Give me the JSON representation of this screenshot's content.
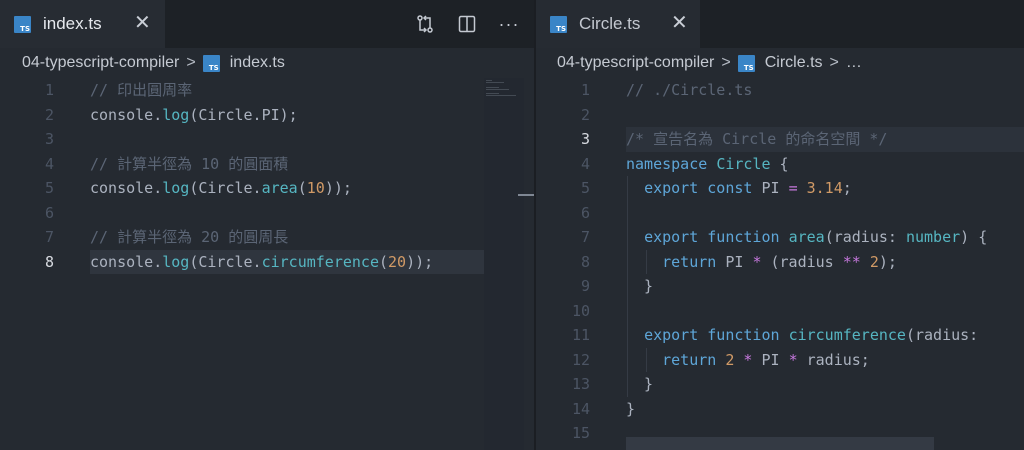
{
  "left": {
    "tab": {
      "icon_text": "TS",
      "name": "index.ts",
      "close": "✕"
    },
    "actions": {
      "compare_icon": "git-compare-icon",
      "split_icon": "split-editor-icon",
      "more": "···"
    },
    "breadcrumb": {
      "folder": "04-typescript-compiler",
      "sep": ">",
      "file": "index.ts"
    },
    "active_line": 8,
    "lines": [
      {
        "n": "1",
        "tokens": [
          {
            "t": "// 印出圓周率",
            "c": "comment"
          }
        ]
      },
      {
        "n": "2",
        "tokens": [
          {
            "t": "console",
            "c": "ident"
          },
          {
            "t": ".",
            "c": "punc"
          },
          {
            "t": "log",
            "c": "fn"
          },
          {
            "t": "(Circle.PI);",
            "c": "punc"
          }
        ]
      },
      {
        "n": "3",
        "tokens": []
      },
      {
        "n": "4",
        "tokens": [
          {
            "t": "// 計算半徑為 10 的圓面積",
            "c": "comment"
          }
        ]
      },
      {
        "n": "5",
        "tokens": [
          {
            "t": "console",
            "c": "ident"
          },
          {
            "t": ".",
            "c": "punc"
          },
          {
            "t": "log",
            "c": "fn"
          },
          {
            "t": "(Circle.",
            "c": "punc"
          },
          {
            "t": "area",
            "c": "fn"
          },
          {
            "t": "(",
            "c": "punc"
          },
          {
            "t": "10",
            "c": "num"
          },
          {
            "t": "));",
            "c": "punc"
          }
        ]
      },
      {
        "n": "6",
        "tokens": []
      },
      {
        "n": "7",
        "tokens": [
          {
            "t": "// 計算半徑為 20 的圓周長",
            "c": "comment"
          }
        ]
      },
      {
        "n": "8",
        "tokens": [
          {
            "t": "console",
            "c": "ident"
          },
          {
            "t": ".",
            "c": "punc"
          },
          {
            "t": "log",
            "c": "fn"
          },
          {
            "t": "(Circle.",
            "c": "punc"
          },
          {
            "t": "circumference",
            "c": "fn"
          },
          {
            "t": "(",
            "c": "punc"
          },
          {
            "t": "20",
            "c": "num"
          },
          {
            "t": "));",
            "c": "punc"
          }
        ]
      }
    ]
  },
  "right": {
    "tab": {
      "icon_text": "TS",
      "name": "Circle.ts",
      "close": "✕"
    },
    "breadcrumb": {
      "folder": "04-typescript-compiler",
      "sep": ">",
      "file": "Circle.ts",
      "sep2": ">",
      "more": "…"
    },
    "active_line": 3,
    "lines": [
      {
        "n": "1",
        "tokens": [
          {
            "t": "// ./Circle.ts",
            "c": "comment"
          }
        ]
      },
      {
        "n": "2",
        "tokens": []
      },
      {
        "n": "3",
        "tokens": [
          {
            "t": "/* 宣告名為 Circle 的命名空間 */",
            "c": "comment"
          }
        ]
      },
      {
        "n": "4",
        "tokens": [
          {
            "t": "namespace ",
            "c": "kw"
          },
          {
            "t": "Circle",
            "c": "type"
          },
          {
            "t": " {",
            "c": "punc"
          }
        ]
      },
      {
        "n": "5",
        "tokens": [
          {
            "t": "  ",
            "c": "punc"
          },
          {
            "t": "export ",
            "c": "kw"
          },
          {
            "t": "const ",
            "c": "kw"
          },
          {
            "t": "PI ",
            "c": "ident"
          },
          {
            "t": "= ",
            "c": "op"
          },
          {
            "t": "3.14",
            "c": "num"
          },
          {
            "t": ";",
            "c": "punc"
          }
        ]
      },
      {
        "n": "6",
        "tokens": []
      },
      {
        "n": "7",
        "tokens": [
          {
            "t": "  ",
            "c": "punc"
          },
          {
            "t": "export ",
            "c": "kw"
          },
          {
            "t": "function ",
            "c": "kw"
          },
          {
            "t": "area",
            "c": "fn"
          },
          {
            "t": "(radius: ",
            "c": "punc"
          },
          {
            "t": "number",
            "c": "type"
          },
          {
            "t": ") {",
            "c": "punc"
          }
        ]
      },
      {
        "n": "8",
        "tokens": [
          {
            "t": "    ",
            "c": "punc"
          },
          {
            "t": "return ",
            "c": "kw"
          },
          {
            "t": "PI ",
            "c": "ident"
          },
          {
            "t": "* ",
            "c": "op"
          },
          {
            "t": "(radius ",
            "c": "punc"
          },
          {
            "t": "** ",
            "c": "op"
          },
          {
            "t": "2",
            "c": "num"
          },
          {
            "t": ");",
            "c": "punc"
          }
        ]
      },
      {
        "n": "9",
        "tokens": [
          {
            "t": "  }",
            "c": "punc"
          }
        ]
      },
      {
        "n": "10",
        "tokens": []
      },
      {
        "n": "11",
        "tokens": [
          {
            "t": "  ",
            "c": "punc"
          },
          {
            "t": "export ",
            "c": "kw"
          },
          {
            "t": "function ",
            "c": "kw"
          },
          {
            "t": "circumference",
            "c": "fn"
          },
          {
            "t": "(radius:",
            "c": "punc"
          }
        ]
      },
      {
        "n": "12",
        "tokens": [
          {
            "t": "    ",
            "c": "punc"
          },
          {
            "t": "return ",
            "c": "kw"
          },
          {
            "t": "2 ",
            "c": "num"
          },
          {
            "t": "* ",
            "c": "op"
          },
          {
            "t": "PI ",
            "c": "ident"
          },
          {
            "t": "* ",
            "c": "op"
          },
          {
            "t": "radius;",
            "c": "punc"
          }
        ]
      },
      {
        "n": "13",
        "tokens": [
          {
            "t": "  }",
            "c": "punc"
          }
        ]
      },
      {
        "n": "14",
        "tokens": [
          {
            "t": "}",
            "c": "punc"
          }
        ]
      },
      {
        "n": "15",
        "tokens": []
      }
    ]
  },
  "colors": {
    "background": "#252a31",
    "tabbar": "#1d2126",
    "ts_icon": "#3a85c7",
    "comment": "#5b6575",
    "keyword": "#5ea6d8",
    "function": "#56b6c2",
    "number": "#d19a66",
    "operator": "#c678dd",
    "text": "#abb2bf"
  }
}
